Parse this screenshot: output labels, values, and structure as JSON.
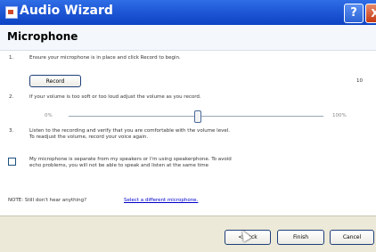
{
  "window": {
    "title": "Audio Wizard",
    "help_label": "?",
    "close_label": "X"
  },
  "page": {
    "heading": "Microphone"
  },
  "steps": [
    {
      "num": "1.",
      "text": "Ensure your microphone is in place and click Record to begin."
    },
    {
      "num": "2.",
      "text": "If your volume is too soft or too loud adjust the volume as you record."
    },
    {
      "num": "3.",
      "line1": "Listen to the recording and verify that you are comfortable with the volume level.",
      "line2": "To readjust the volume, record your voice again."
    }
  ],
  "record": {
    "label": "Record",
    "count": "10"
  },
  "volume": {
    "min_label": "0%",
    "max_label": "100%",
    "level": 0.55
  },
  "speakerphone": {
    "checked": false,
    "line1": "My microphone is separate from my speakers or I'm using speakerphone. To avoid",
    "line2": "echo problems, you will not be able to speak and listen at the same time"
  },
  "note": {
    "prefix": "NOTE:  Still don't hear anything?",
    "link": "Select a different microphone."
  },
  "buttons": {
    "back": "< Back",
    "finish": "Finish",
    "cancel": "Cancel"
  }
}
